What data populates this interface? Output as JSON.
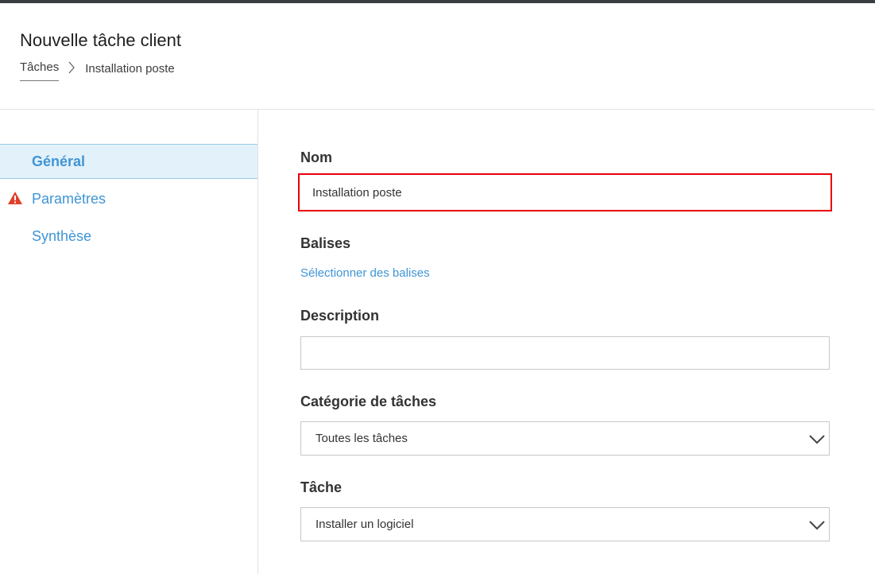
{
  "header": {
    "title": "Nouvelle tâche client",
    "breadcrumb": {
      "parent": "Tâches",
      "current": "Installation poste"
    }
  },
  "sidebar": {
    "items": [
      {
        "label": "Général",
        "active": true,
        "warning": false
      },
      {
        "label": "Paramètres",
        "active": false,
        "warning": true
      },
      {
        "label": "Synthèse",
        "active": false,
        "warning": false
      }
    ]
  },
  "form": {
    "name": {
      "label": "Nom",
      "value": "Installation poste"
    },
    "tags": {
      "label": "Balises",
      "link": "Sélectionner des balises"
    },
    "description": {
      "label": "Description",
      "value": ""
    },
    "category": {
      "label": "Catégorie de tâches",
      "selected": "Toutes les tâches"
    },
    "task": {
      "label": "Tâche",
      "selected": "Installer un logiciel"
    }
  },
  "colors": {
    "accent": "#3f95d6",
    "active_bg": "#e3f1fa",
    "error_outline": "#e8000b",
    "warning": "#e0402b",
    "topbar": "#3a3d41"
  },
  "icons": {
    "breadcrumb_separator": "chevron-right-icon",
    "warning": "warning-triangle-icon",
    "dropdown": "chevron-down-icon"
  }
}
